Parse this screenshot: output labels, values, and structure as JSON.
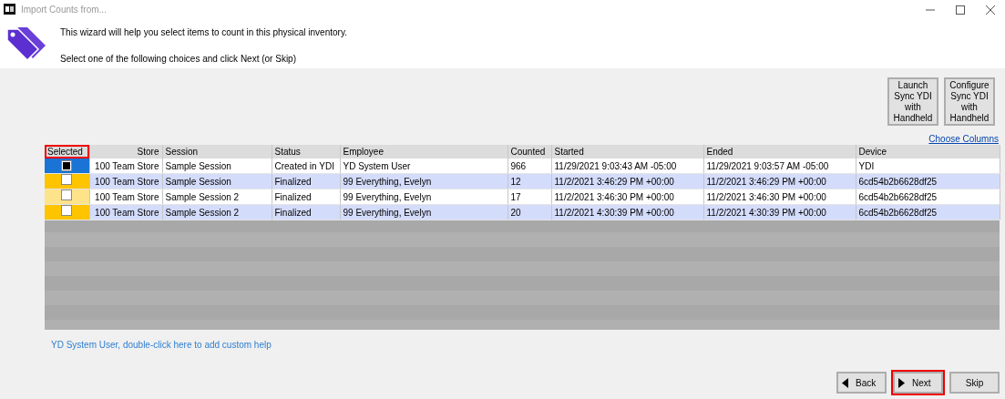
{
  "window": {
    "title": "Import Counts from..."
  },
  "intro": [
    "This wizard will help you select items to count in this physical inventory.",
    "Select one of the following choices and click Next (or Skip)"
  ],
  "side_buttons": [
    "Launch Sync YDI with Handheld",
    "Configure Sync YDI with Handheld"
  ],
  "choose_columns": "Choose Columns",
  "table": {
    "selector_column": {
      "label": "Selected",
      "highlighted": true
    },
    "columns": [
      "Store",
      "Session",
      "Status",
      "Employee",
      "Counted",
      "Started",
      "Ended",
      "Device"
    ],
    "rows": [
      {
        "selected": true,
        "checked": true,
        "cells": [
          "100 Team Store",
          "Sample Session",
          "Created in YDI",
          "YD System User",
          "966",
          "11/29/2021 9:03:43 AM -05:00",
          "11/29/2021 9:03:57 AM -05:00",
          "YDI"
        ]
      },
      {
        "selected": false,
        "checked": false,
        "cells": [
          "100 Team Store",
          "Sample Session",
          "Finalized",
          "99 Everything, Evelyn",
          "12",
          "11/2/2021 3:46:29 PM +00:00",
          "11/2/2021 3:46:29 PM +00:00",
          "6cd54b2b6628df25"
        ]
      },
      {
        "selected": false,
        "checked": false,
        "cells": [
          "100 Team Store",
          "Sample Session 2",
          "Finalized",
          "99 Everything, Evelyn",
          "17",
          "11/2/2021 3:46:30 PM +00:00",
          "11/2/2021 3:46:30 PM +00:00",
          "6cd54b2b6628df25"
        ]
      },
      {
        "selected": false,
        "checked": false,
        "cells": [
          "100 Team Store",
          "Sample Session 2",
          "Finalized",
          "99 Everything, Evelyn",
          "20",
          "11/2/2021 4:30:39 PM +00:00",
          "11/2/2021 4:30:39 PM +00:00",
          "6cd54b2b6628df25"
        ]
      }
    ]
  },
  "help_link": "YD System User, double-click here to add custom help",
  "nav_buttons": [
    {
      "kind": "back",
      "label": "Back",
      "highlighted": false
    },
    {
      "kind": "next",
      "label": "Next",
      "highlighted": true
    },
    {
      "kind": "skip",
      "label": "Skip",
      "highlighted": false
    }
  ]
}
